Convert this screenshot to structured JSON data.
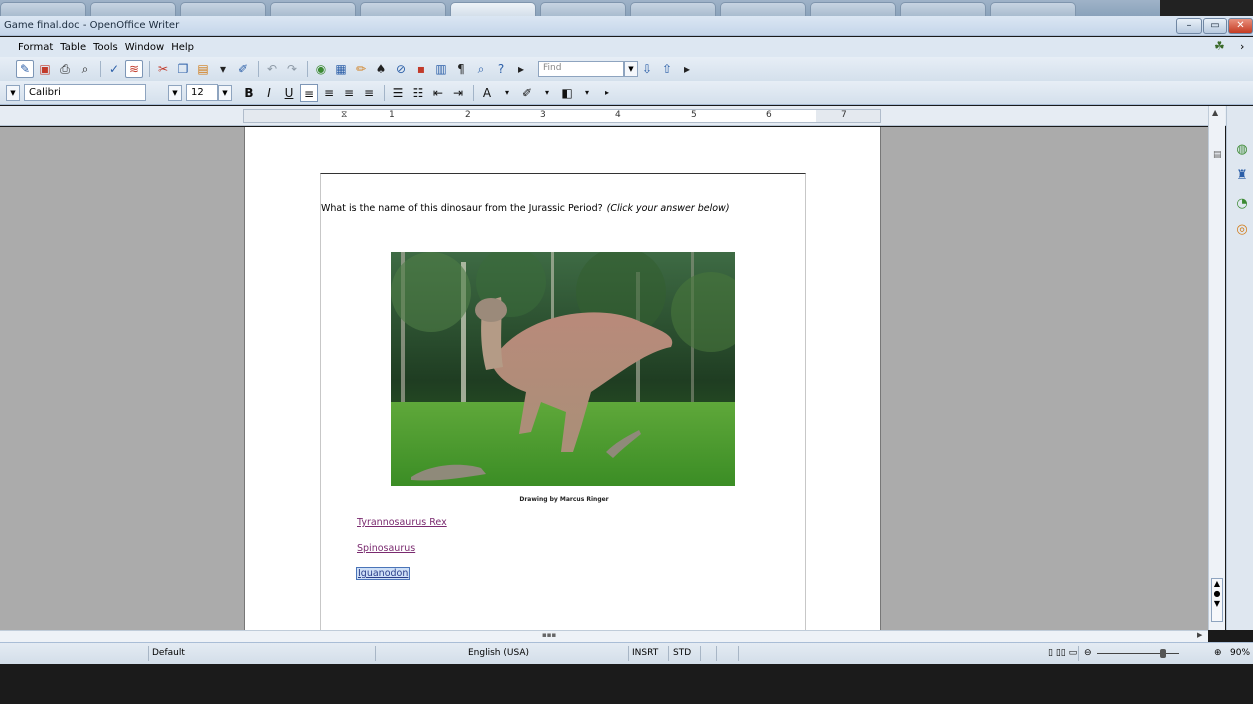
{
  "window": {
    "title": "Game final.doc - OpenOffice Writer"
  },
  "menubar": {
    "items": [
      "Format",
      "Table",
      "Tools",
      "Window",
      "Help"
    ]
  },
  "toolbar": {
    "find_placeholder": "Find"
  },
  "format_toolbar": {
    "paragraph_style": "",
    "font_name": "Calibri",
    "font_size": "12",
    "bold_label": "B",
    "italic_label": "I",
    "underline_label": "U"
  },
  "ruler": {
    "numbers": [
      "1",
      "2",
      "3",
      "4",
      "5",
      "6",
      "7"
    ]
  },
  "document": {
    "question": "What is the name of this dinosaur from the Jurassic Period?",
    "question_note": "(Click your answer below)",
    "caption": "Drawing by Marcus Ringer",
    "answers": [
      "Tyrannosaurus Rex",
      "Spinosaurus",
      "Iguanodon"
    ]
  },
  "statusbar": {
    "page_style": "Default",
    "language": "English (USA)",
    "insert_mode": "INSRT",
    "selection_mode": "STD",
    "zoom": "90%"
  },
  "colors": {
    "link": "#7a2a6f",
    "selection": "#cfe0f7",
    "titlebar": "#c5d6ea"
  }
}
